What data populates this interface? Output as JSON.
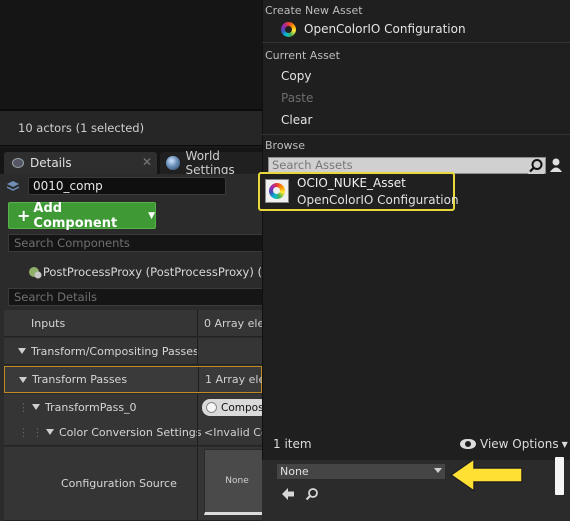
{
  "status": {
    "actors_text": "10 actors (1 selected)"
  },
  "tabs": {
    "details": "Details",
    "world_settings": "World Settings",
    "close": "✕"
  },
  "details": {
    "actor_name": "0010_comp",
    "add_component_label": "Add Component",
    "search_components_placeholder": "Search Components",
    "component_text": "PostProcessProxy (PostProcessProxy) (",
    "search_details_placeholder": "Search Details",
    "rows": {
      "inputs_label": "Inputs",
      "inputs_value": "0 Array elem",
      "tcp_label": "Transform/Compositing Passes",
      "tp_label": "Transform Passes",
      "tp_value": "1 Array elem",
      "tp0_label": "TransformPass_0",
      "tp0_value": "Compos",
      "ccs_label": "Color Conversion Settings",
      "ccs_value": "<Invalid Con",
      "cfg_label": "Configuration Source",
      "thumb_label": "None"
    }
  },
  "picker": {
    "create_header": "Create New Asset",
    "create_item": "OpenColorIO Configuration",
    "current_header": "Current Asset",
    "copy": "Copy",
    "paste": "Paste",
    "clear": "Clear",
    "browse_header": "Browse",
    "search_placeholder": "Search Assets",
    "asset_name": "OCIO_NUKE_Asset",
    "asset_type": "OpenColorIO Configuration",
    "item_count": "1 item",
    "view_options": "View Options",
    "combo_value": "None"
  },
  "colors": {
    "highlight": "#e8d83c",
    "add_button": "#3f9a36",
    "arrow": "#ffe033"
  }
}
